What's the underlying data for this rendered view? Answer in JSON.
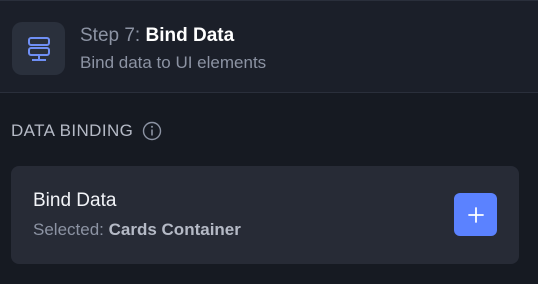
{
  "step": {
    "prefix": "Step 7:",
    "name": "Bind Data",
    "subtitle": "Bind data to UI elements",
    "icon": "database-stack-icon"
  },
  "section": {
    "title": "DATA BINDING",
    "info_icon": "info-icon"
  },
  "bind_card": {
    "title": "Bind Data",
    "selected_prefix": "Selected:",
    "selected_value": "Cards Container",
    "add_icon": "plus-icon"
  },
  "colors": {
    "background": "#161a22",
    "header_bg": "#1b1f29",
    "card_bg": "#272b36",
    "accent": "#5b82ff",
    "icon_accent": "#6f8ff5",
    "muted_text": "#8c93a3"
  }
}
